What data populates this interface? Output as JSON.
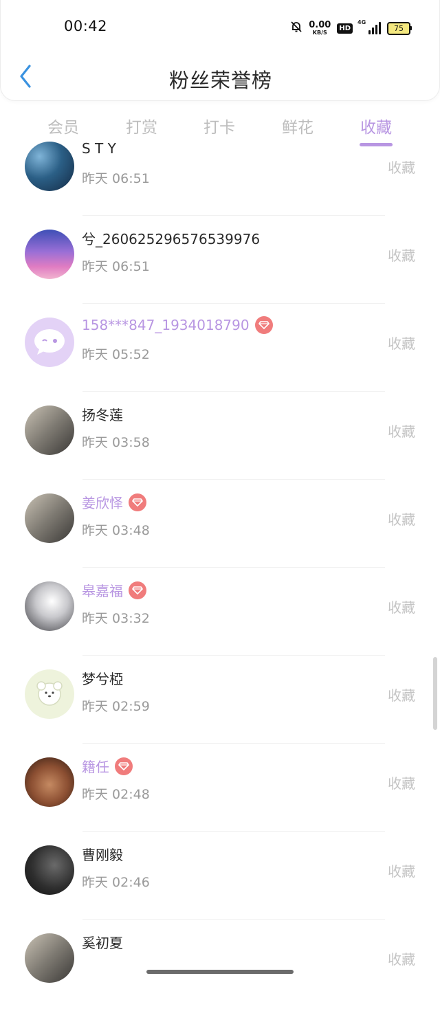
{
  "status_bar": {
    "time": "00:42",
    "net_speed_value": "0.00",
    "net_speed_unit": "KB/S",
    "hd_label": "HD",
    "network_type": "4G",
    "battery_level": "75"
  },
  "header": {
    "title": "粉丝荣誉榜"
  },
  "tabs": [
    {
      "label": "会员",
      "active": false
    },
    {
      "label": "打赏",
      "active": false
    },
    {
      "label": "打卡",
      "active": false
    },
    {
      "label": "鲜花",
      "active": false
    },
    {
      "label": "收藏",
      "active": true
    }
  ],
  "colors": {
    "accent": "#b896e2",
    "badge": "#f07c7c",
    "muted_text": "#9a9a9a",
    "action_text": "#c4c4c4"
  },
  "list": [
    {
      "name": "S T Y",
      "time": "昨天 06:51",
      "action": "收藏",
      "vip": false,
      "avatar": "starry-sky-avatar"
    },
    {
      "name": "兮_260625296576539976",
      "time": "昨天 06:51",
      "action": "收藏",
      "vip": false,
      "avatar": "purple-sunset-avatar"
    },
    {
      "name": "158***847_1934018790",
      "time": "昨天 05:52",
      "action": "收藏",
      "vip": true,
      "avatar": "default-chat-avatar"
    },
    {
      "name": "扬冬莲",
      "time": "昨天 03:58",
      "action": "收藏",
      "vip": false,
      "avatar": "photo-avatar"
    },
    {
      "name": "姜欣怿",
      "time": "昨天 03:48",
      "action": "收藏",
      "vip": true,
      "avatar": "photo-avatar"
    },
    {
      "name": "皋嘉福",
      "time": "昨天 03:32",
      "action": "收藏",
      "vip": true,
      "avatar": "anime-avatar"
    },
    {
      "name": "梦兮椏",
      "time": "昨天 02:59",
      "action": "收藏",
      "vip": false,
      "avatar": "bear-doodle-avatar"
    },
    {
      "name": "籍任",
      "time": "昨天 02:48",
      "action": "收藏",
      "vip": true,
      "avatar": "sunglasses-avatar"
    },
    {
      "name": "曹刚毅",
      "time": "昨天 02:46",
      "action": "收藏",
      "vip": false,
      "avatar": "dark-photo-avatar"
    },
    {
      "name": "奚初夏",
      "time": "",
      "action": "收藏",
      "vip": false,
      "avatar": "photo-avatar"
    }
  ]
}
